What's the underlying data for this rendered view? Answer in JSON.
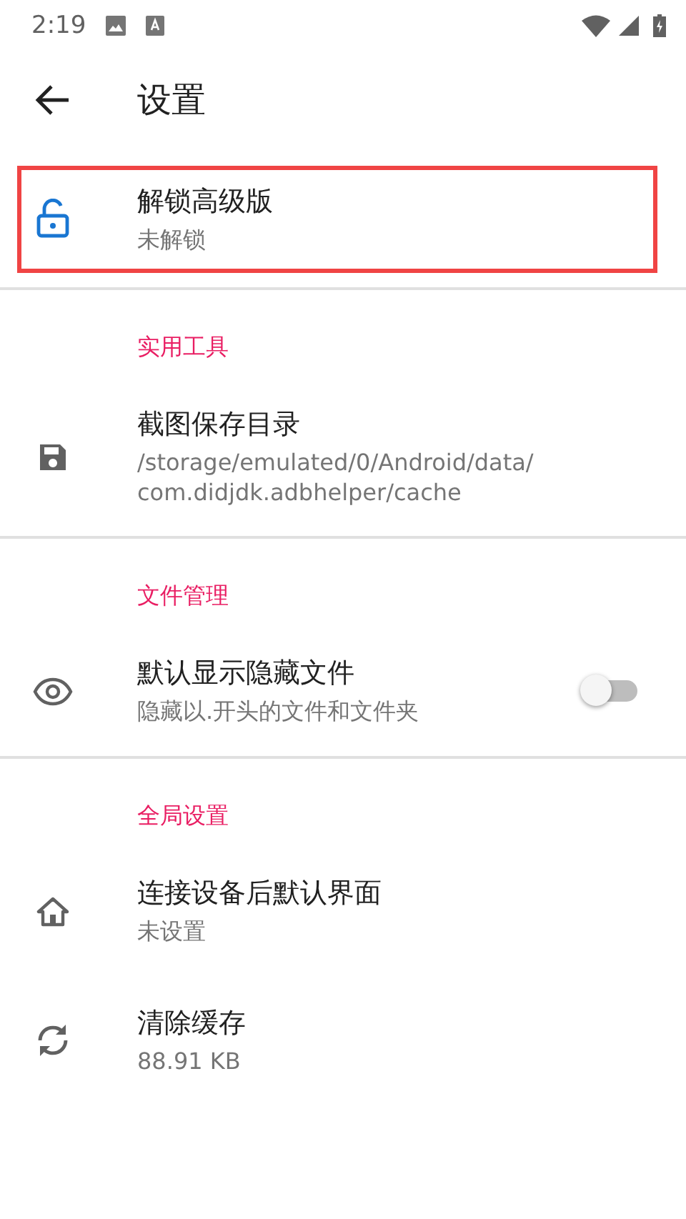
{
  "status_bar": {
    "time": "2:19"
  },
  "toolbar": {
    "title": "设置"
  },
  "premium": {
    "title": "解锁高级版",
    "summary": "未解锁",
    "highlighted": true
  },
  "categories": [
    {
      "title": "实用工具",
      "items": [
        {
          "kind": "plain",
          "title": "截图保存目录",
          "summary": "/storage/emulated/0/Android/data/com.didjdk.adbhelper/cache"
        }
      ]
    },
    {
      "title": "文件管理",
      "items": [
        {
          "kind": "switch",
          "title": "默认显示隐藏文件",
          "summary": "隐藏以.开头的文件和文件夹",
          "on": false
        }
      ]
    },
    {
      "title": "全局设置",
      "items": [
        {
          "kind": "plain",
          "title": "连接设备后默认界面",
          "summary": "未设置"
        },
        {
          "kind": "plain",
          "title": "清除缓存",
          "summary": "88.91 KB"
        }
      ]
    }
  ]
}
